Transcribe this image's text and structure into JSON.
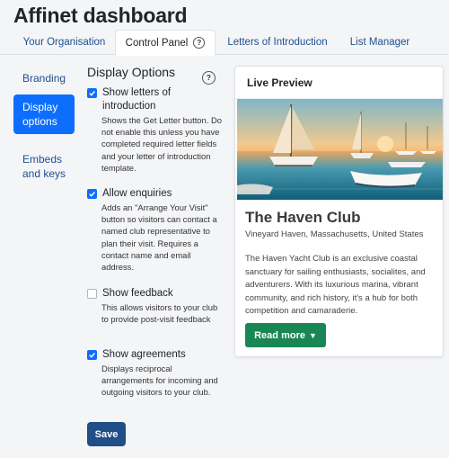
{
  "page": {
    "title": "Affinet dashboard"
  },
  "tabs": [
    {
      "label": "Your Organisation",
      "active": false
    },
    {
      "label": "Control Panel",
      "active": true,
      "help": "?"
    },
    {
      "label": "Letters of Introduction",
      "active": false
    },
    {
      "label": "List Manager",
      "active": false
    }
  ],
  "sidebar": {
    "items": [
      {
        "label": "Branding",
        "active": false
      },
      {
        "label": "Display options",
        "active": true
      },
      {
        "label": "Embeds and keys",
        "active": false
      }
    ]
  },
  "options": {
    "title": "Display Options",
    "help": "?",
    "items": [
      {
        "label": "Show letters of introduction",
        "checked": true,
        "description": "Shows the Get Letter button. Do not enable this unless you have completed required letter fields and your letter of introduction template."
      },
      {
        "label": "Allow enquiries",
        "checked": true,
        "description": "Adds an \"Arrange Your Visit\" button so visitors can contact a named club representative to plan their visit. Requires a contact name and email address."
      },
      {
        "label": "Show feedback",
        "checked": false,
        "description": "This allows visitors to your club to provide post-visit feedback"
      },
      {
        "label": "Show agreements",
        "checked": true,
        "description": "Displays reciprocal arrangements for incoming and outgoing visitors to your club."
      }
    ],
    "save_label": "Save"
  },
  "preview": {
    "header": "Live Preview",
    "club_name": "The Haven Club",
    "location": "Vineyard Haven, Massachusetts, United States",
    "description": "The Haven Yacht Club is an exclusive coastal sanctuary for sailing enthusiasts, socialites, and adventurers. With its luxurious marina, vibrant community, and rich history, it's a hub for both competition and camaraderie.",
    "read_more_label": "Read more",
    "read_more_icon": "caret-down-icon"
  },
  "colors": {
    "primary": "#0d6efd",
    "save_button": "#1f4e88",
    "read_more": "#198754",
    "link": "#1f4f8f"
  }
}
